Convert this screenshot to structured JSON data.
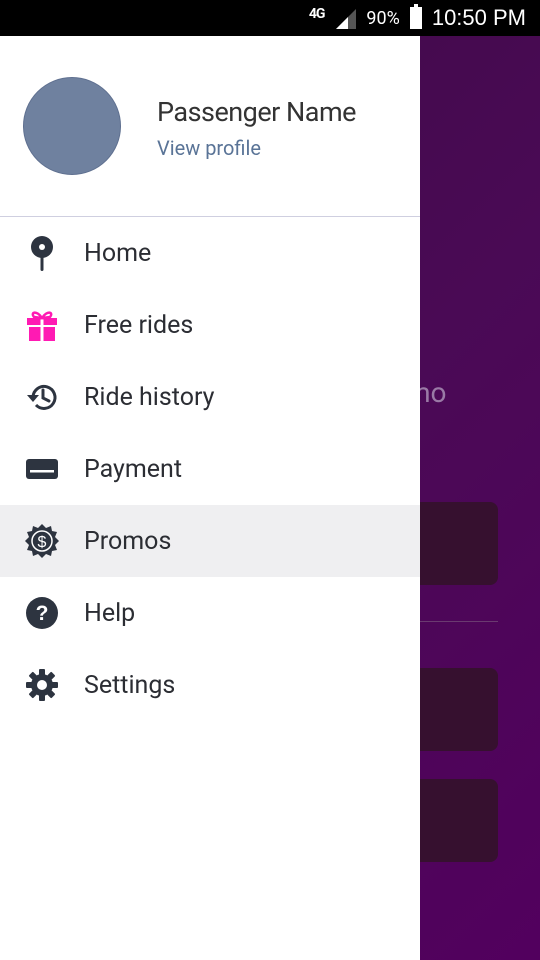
{
  "status_bar": {
    "network": "4G",
    "battery": "90%",
    "time": "10:50 PM"
  },
  "background": {
    "partial_text": "omo"
  },
  "drawer": {
    "profile": {
      "name": "Passenger Name",
      "link": "View profile"
    },
    "menu": [
      {
        "label": "Home",
        "icon": "map-pin-icon"
      },
      {
        "label": "Free rides",
        "icon": "gift-icon",
        "color": "#ff1ab3"
      },
      {
        "label": "Ride history",
        "icon": "history-icon"
      },
      {
        "label": "Payment",
        "icon": "credit-card-icon"
      },
      {
        "label": "Promos",
        "icon": "promo-badge-icon",
        "active": true
      },
      {
        "label": "Help",
        "icon": "help-icon"
      },
      {
        "label": "Settings",
        "icon": "gear-icon"
      }
    ]
  },
  "colors": {
    "icon_dark": "#2d3440",
    "gift": "#ff1ab3",
    "link": "#5a7497",
    "active_bg": "#efeff1"
  }
}
